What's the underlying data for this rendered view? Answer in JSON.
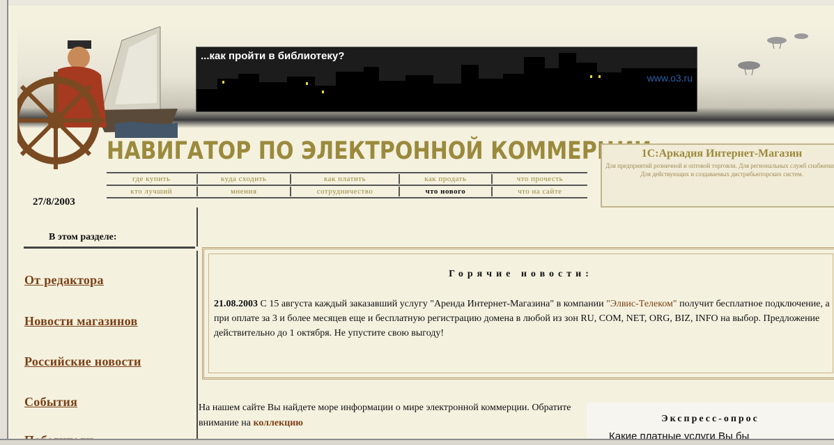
{
  "banner": {
    "slogan": "...как пройти в библиотеку?",
    "url": "www.o3.ru"
  },
  "site_title": "НАВИГАТОР ПО ЭЛЕКТРОННОЙ КОММЕРЦИИ",
  "nav": {
    "row1": [
      "где купить",
      "куда сходить",
      "как платить",
      "как продать",
      "что прочесть"
    ],
    "row2": [
      "кто лучший",
      "мнения",
      "сотрудничество",
      "что нового",
      "что на сайте"
    ],
    "current": "что нового"
  },
  "date": "27/8/2003",
  "ad": {
    "title": "1С:Аркадия Интернет-Магазин",
    "text": "Для предприятий розничной и оптовой торговли. Для региональных служб снабжения. Для действующих и создаваемых дистрибьюторских систем."
  },
  "sidebar": {
    "title": "В этом разделе:",
    "links": [
      "От редактора",
      "Новости магазинов",
      "Российские новости",
      "События",
      "Победители"
    ]
  },
  "news": {
    "title": "Горячие  новости:",
    "date": "21.08.2003",
    "text_before": " С 15 августа каждый заказавший услугу \"Аренда Интернет-Магазина\" в компании ",
    "link": "\"Элвис-Телеком\"",
    "text_after": " получит бесплатное подключение, а при оплате за 3 и более месяцев еще и бесплатную регистрацию домена в любой из зон RU, COM, NET, ORG, BIZ, INFO на выбор. Предложение действительно до 1 октября. Не упустите свою выгоду!"
  },
  "intro": {
    "text": "На нашем сайте Вы найдете море информации о мире электронной коммерции. Обратите внимание на ",
    "link": "коллекцию"
  },
  "poll": {
    "title": "Экспресс-опрос",
    "question": "Какие платные услуги Вы бы"
  }
}
